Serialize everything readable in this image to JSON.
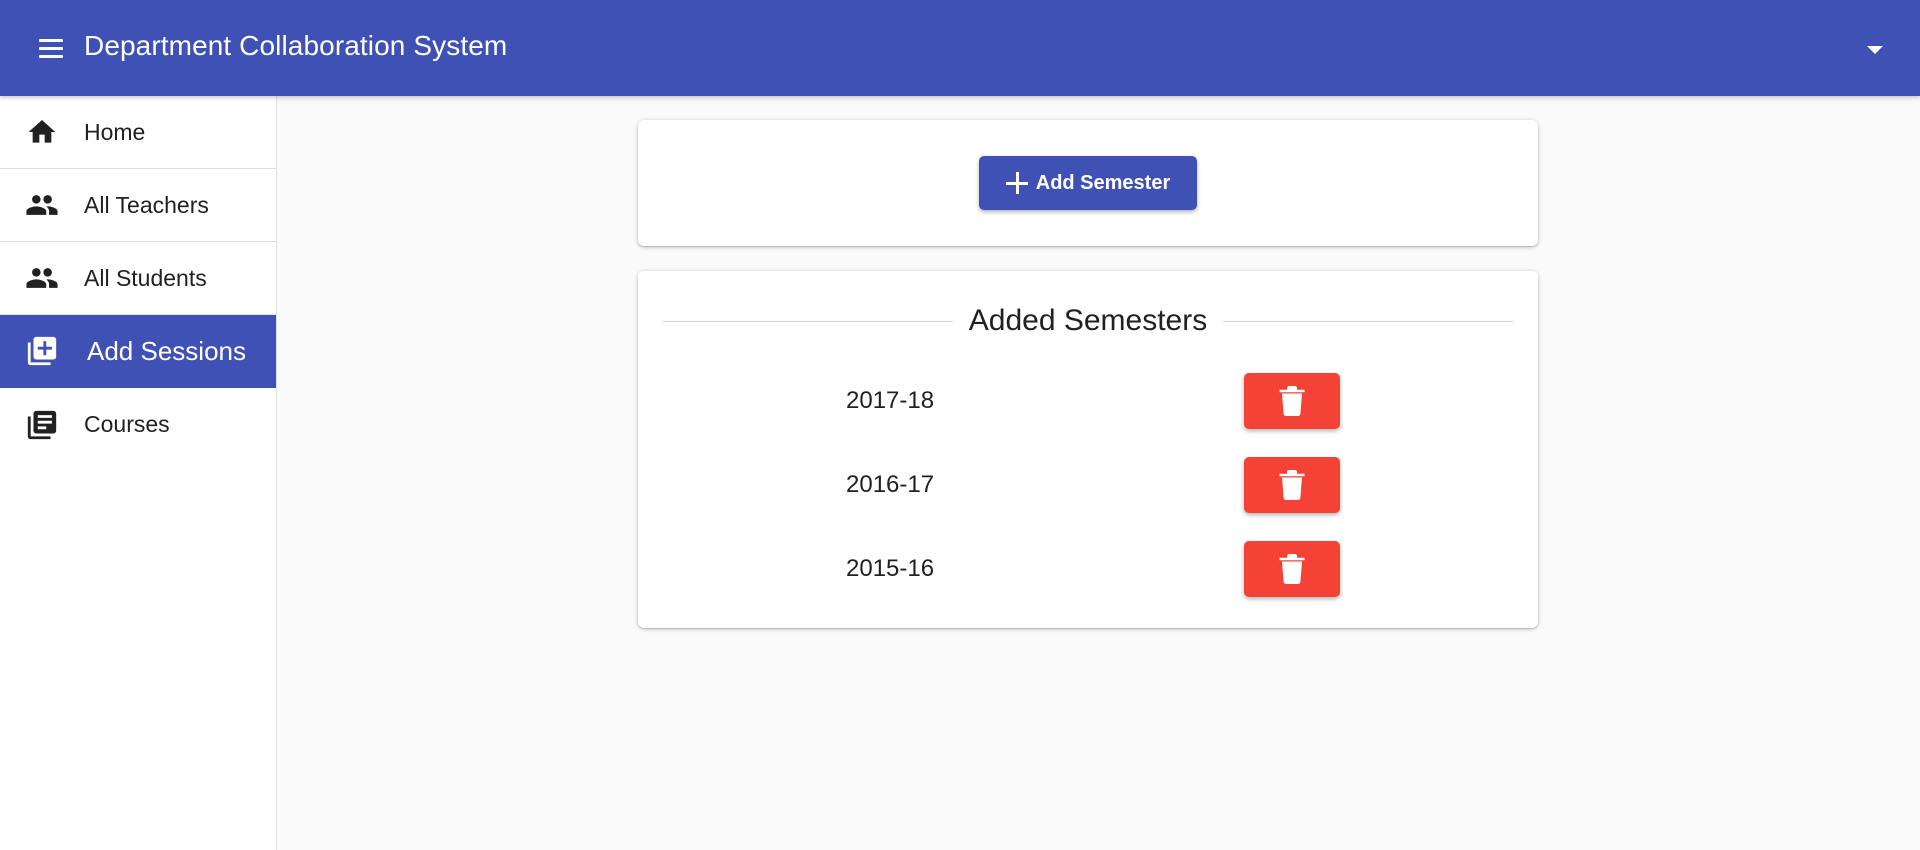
{
  "app": {
    "title": "Department Collaboration System",
    "header_color": "#3f51b5"
  },
  "header": {
    "menu_icon": "menu-icon",
    "account_dropdown_icon": "arrow-drop-down-icon"
  },
  "sidebar": {
    "items": [
      {
        "label": "Home",
        "icon": "home-icon",
        "active": false
      },
      {
        "label": "All Teachers",
        "icon": "people-icon",
        "active": false
      },
      {
        "label": "All Students",
        "icon": "people-icon",
        "active": false
      },
      {
        "label": "Add Sessions",
        "icon": "library-add-icon",
        "active": true
      },
      {
        "label": "Courses",
        "icon": "library-books-icon",
        "active": false
      }
    ]
  },
  "main": {
    "add_semester_button": {
      "label": "Add Semester",
      "icon": "plus-icon"
    },
    "semesters_section": {
      "heading": "Added Semesters",
      "items": [
        {
          "name": "2017-18",
          "delete_icon": "trash-icon"
        },
        {
          "name": "2016-17",
          "delete_icon": "trash-icon"
        },
        {
          "name": "2015-16",
          "delete_icon": "trash-icon"
        }
      ]
    }
  },
  "colors": {
    "primary": "#3f51b5",
    "danger": "#f44336",
    "background": "#fafafa"
  }
}
